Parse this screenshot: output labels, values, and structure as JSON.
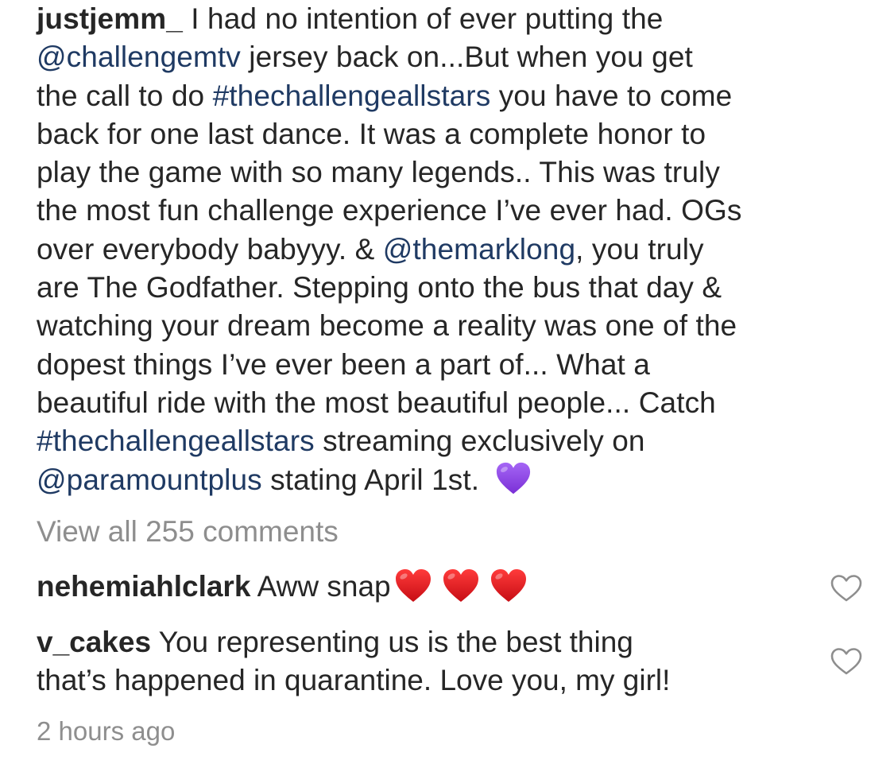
{
  "caption": {
    "username": "justjemm_",
    "seg1": " I had no intention of ever putting the",
    "mention_challengemtv": "@challengemtv",
    "seg2": " jersey back on...But when you get",
    "seg3": "the call to do ",
    "hashtag_1": "#thechallengeallstars",
    "seg4": " you have to come",
    "line4": "back for one last dance. It was a complete honor to",
    "line5": "play the game with so many legends.. This was truly",
    "line6": "the most fun challenge experience I’ve ever had. OGs",
    "seg7a": "over everybody babyyy. & ",
    "mention_themarklong": "@themarklong",
    "seg7b": ", you truly",
    "line8": "are The Godfather. Stepping onto the bus that day &",
    "line9": "watching your dream become a reality was one of the",
    "line10": "dopest things I’ve ever been a part of... What a",
    "line11": "beautiful ride with the most beautiful people... Catch",
    "hashtag_2": "#thechallengeallstars",
    "seg12": " streaming exclusively on",
    "mention_paramountplus": "@paramountplus",
    "seg13": " stating April 1st. ",
    "emoji": "purple-heart-emoji"
  },
  "view_all_comments": "View all 255 comments",
  "comments": [
    {
      "username": "nehemiahlclark",
      "text": " Aww snap",
      "emoji": [
        "red-heart-emoji",
        "red-heart-emoji",
        "red-heart-emoji"
      ]
    },
    {
      "username": "v_cakes",
      "text_line1": " You representing us is the best thing",
      "text_line2": "that’s happened in quarantine.  Love you, my girl!"
    }
  ],
  "timestamp": "2 hours ago",
  "icons": {
    "like": "heart-outline-icon"
  },
  "colors": {
    "text": "#262626",
    "link": "#1f3a63",
    "muted": "#8e8e8e",
    "heart_red": "#e0141e",
    "heart_purple": "#8e44e8"
  }
}
